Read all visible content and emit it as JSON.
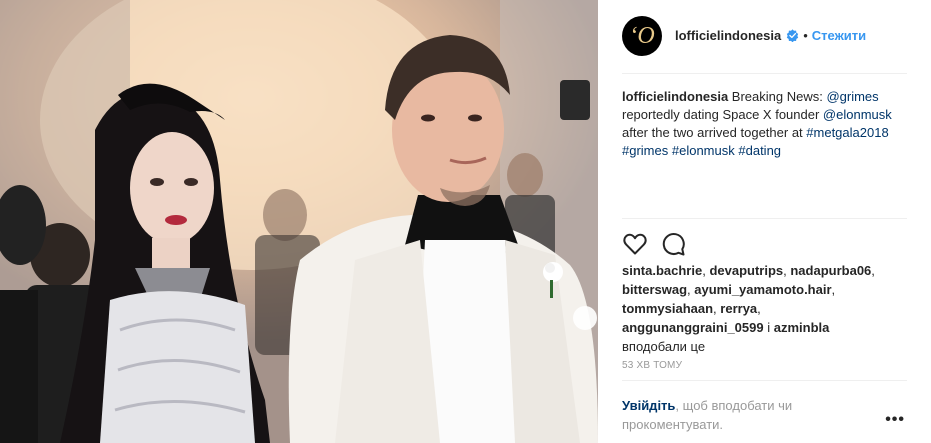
{
  "post": {
    "image_alt": "Grimes and Elon Musk at the Met Gala",
    "header": {
      "avatar_letter": "‘O",
      "username": "lofficielindonesia",
      "dot": "•",
      "follow_label": "Стежити"
    },
    "caption": {
      "username": "lofficielindonesia",
      "t1": " Breaking News: ",
      "m1": "@grimes",
      "t2": " reportedly dating Space X founder ",
      "m2": "@elonmusk",
      "t3": " after the two arrived together at ",
      "h1": "#metgala2018",
      "h2": "#grimes",
      "h3": "#elonmusk",
      "h4": "#dating"
    },
    "likes": {
      "users": [
        "sinta.bachrie",
        "devaputrips",
        "nadapurba06",
        "bitterswag",
        "ayumi_yamamoto.hair",
        "tommysiahaan",
        "rerrya",
        "anggunanggraini_0599"
      ],
      "and_word": "і",
      "last_user": "azminbla",
      "suffix": "вподобали це"
    },
    "timestamp": "53 ХВ ТОМУ",
    "footer": {
      "login_link": "Увійдіть",
      "login_text": ", щоб вподобати чи прокоментувати.",
      "more": "•••"
    }
  },
  "colors": {
    "accent": "#3897f0",
    "link": "#003569",
    "muted": "#999999",
    "border": "#efefef"
  },
  "icons": [
    "verified-badge-icon",
    "heart-icon",
    "comment-icon",
    "more-options-icon"
  ]
}
